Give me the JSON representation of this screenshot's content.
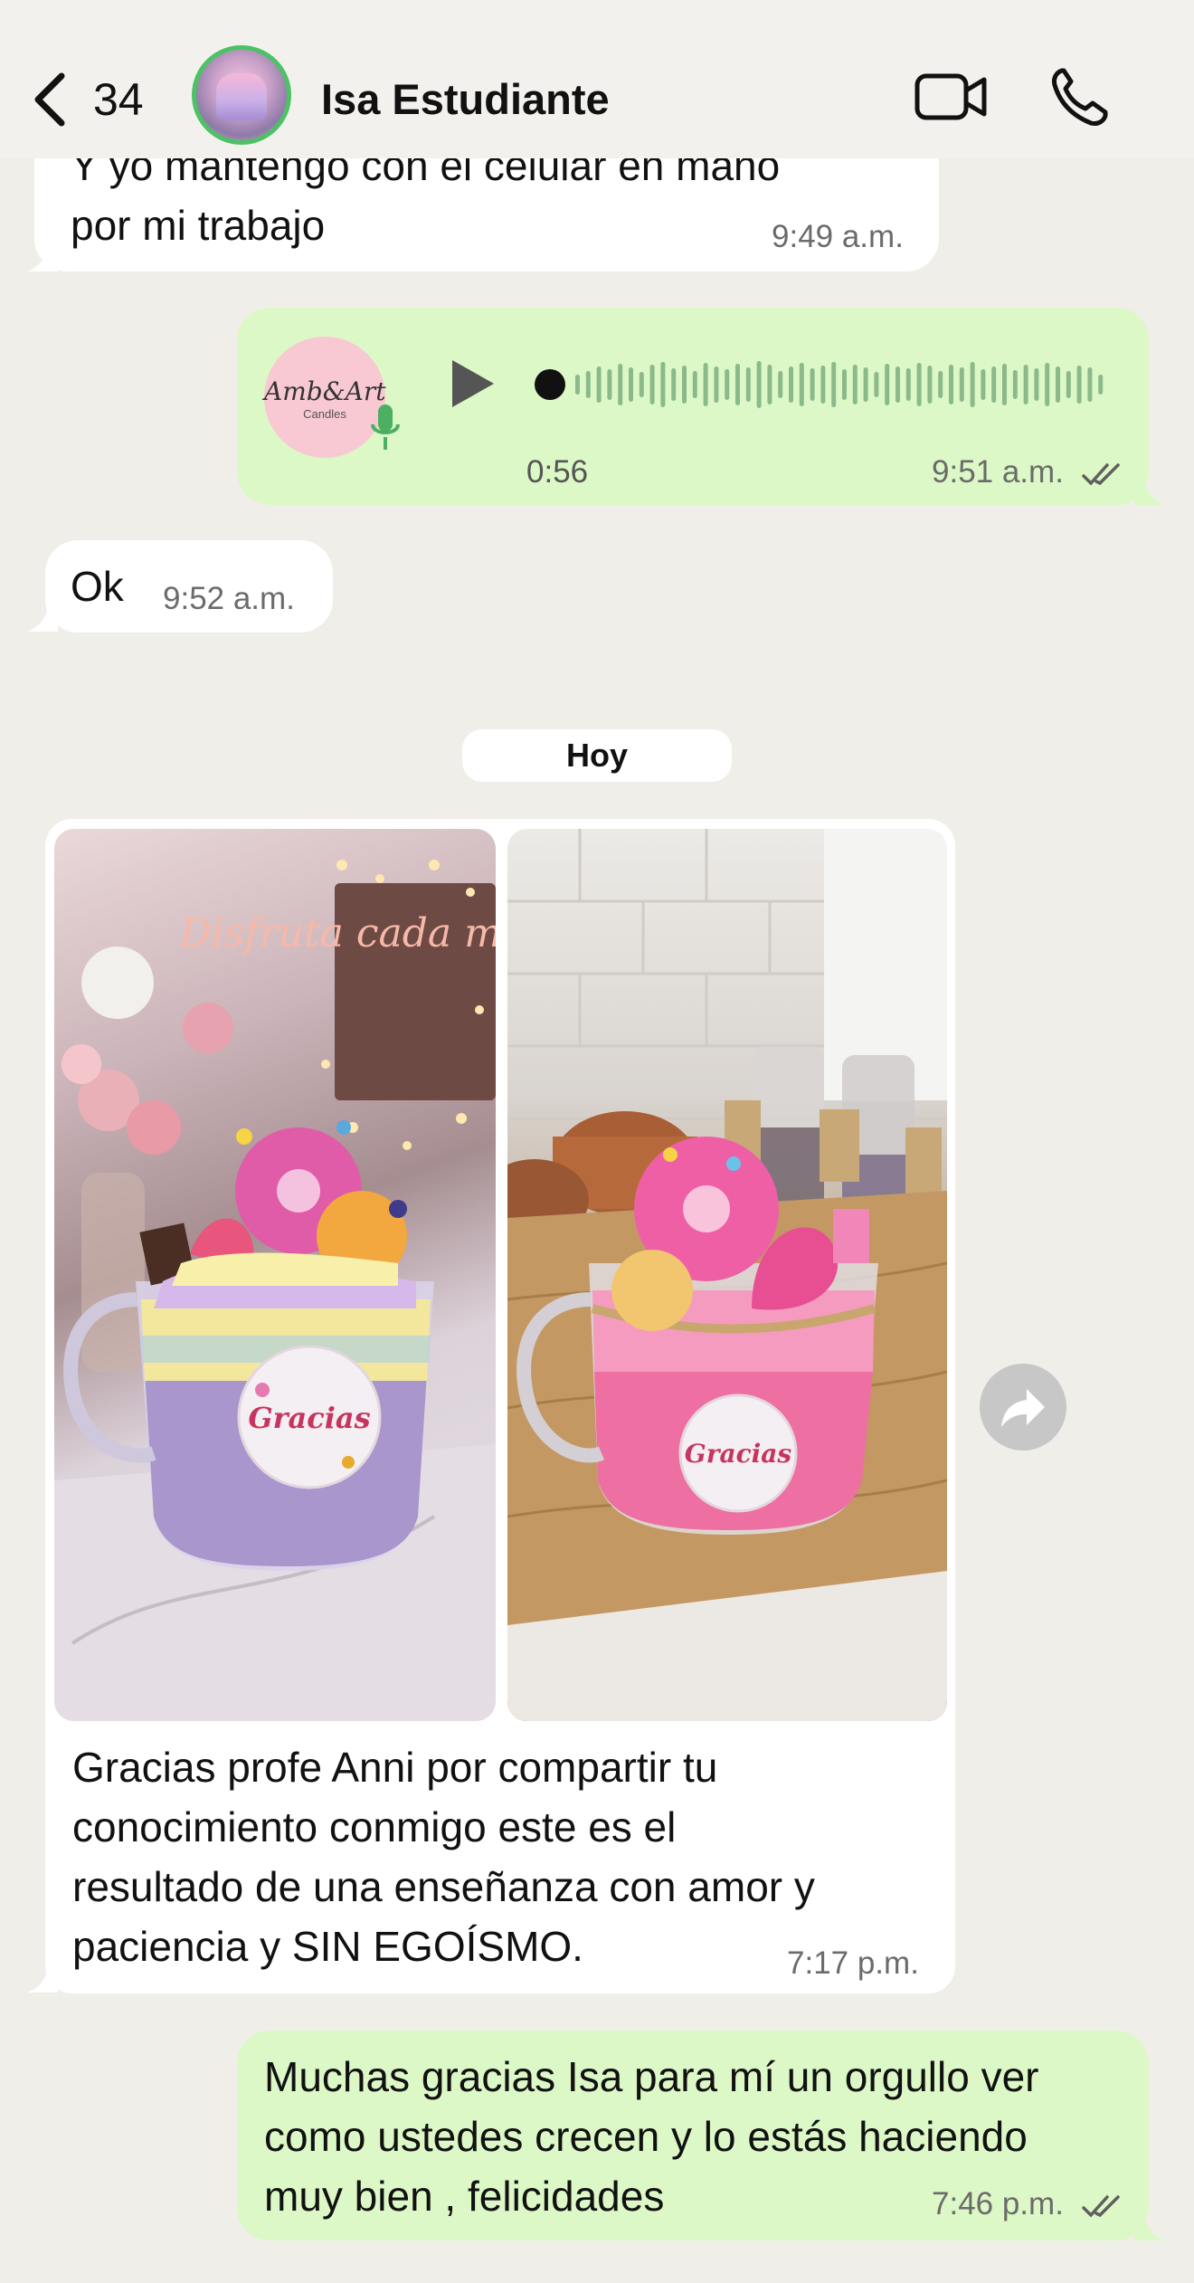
{
  "header": {
    "unread_count": "34",
    "contact_name": "Isa Estudiante"
  },
  "messages": {
    "m1": {
      "text_line1": "Y yo mantengo con el celular en mano",
      "text_line2": "por mi trabajo",
      "time": "9:49 a.m."
    },
    "voice": {
      "avatar_label": "Amb&Art",
      "avatar_sub": "Candles",
      "duration": "0:56",
      "time": "9:51 a.m."
    },
    "m3": {
      "text": "Ok",
      "time": "9:52 a.m."
    },
    "date_separator": "Hoy",
    "photo_msg": {
      "caption_lines": [
        "Gracias profe Anni por compartir tu",
        "conocimiento conmigo este es el",
        "resultado de una enseñanza con amor y",
        "paciencia y SIN EGOÍSMO."
      ],
      "time": "7:17 p.m."
    },
    "m5": {
      "lines": [
        "Muchas gracias Isa para mí un orgullo ver",
        "como ustedes crecen y lo estás haciendo",
        "muy bien , felicidades"
      ],
      "time": "7:46 p.m."
    }
  },
  "photo_labels": {
    "photo1_sign": "Disfruta cada momento",
    "photo1_badge": "Gracias",
    "photo2_badge": "Gracias"
  },
  "colors": {
    "incoming_bubble": "#ffffff",
    "outgoing_bubble": "#dcf8c6",
    "avatar_ring": "#4cc265",
    "read_ticks": "#5f5f5f"
  }
}
